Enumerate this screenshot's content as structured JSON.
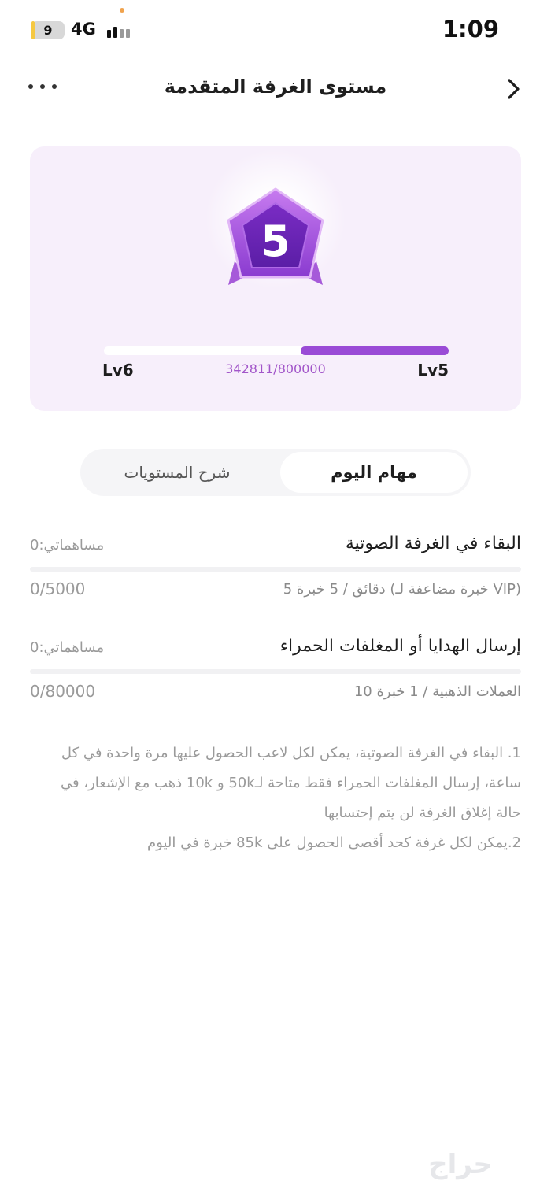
{
  "status_bar": {
    "battery_level": "9",
    "network": "4G",
    "time": "1:09"
  },
  "nav": {
    "title": "مستوى الغرفة المتقدمة"
  },
  "level_card": {
    "badge_number": "5",
    "current_level": "Lv5",
    "next_level": "Lv6",
    "experience_text": "342811/800000",
    "progress_fraction": 0.43,
    "accent_color": "#9a4bd6"
  },
  "tabs": {
    "active": "مهام اليوم",
    "inactive": "شرح المستويات"
  },
  "tasks": [
    {
      "title": "البقاء في الغرفة الصوتية",
      "contribution": "مساهماتي:0",
      "description": "5 دقائق / 5 خبرة (خبرة مضاعفة لـ VIP)",
      "count": "0/5000"
    },
    {
      "title": "إرسال الهدايا أو المغلفات الحمراء",
      "contribution": "مساهماتي:0",
      "description": "10 العملات الذهبية / 1 خبرة",
      "count": "0/80000"
    }
  ],
  "notes": {
    "line1": "1. البقاء في الغرفة الصوتية، يمكن لكل لاعب الحصول عليها مرة واحدة في كل ساعة، إرسال المغلفات الحمراء فقط متاحة لـ50k و 10k ذهب مع الإشعار، في حالة إغلاق الغرفة لن يتم إحتسابها",
    "line2": "2.يمكن لكل غرفة كحد أقصى الحصول على 85k خبرة في اليوم"
  },
  "watermark": "حراج"
}
